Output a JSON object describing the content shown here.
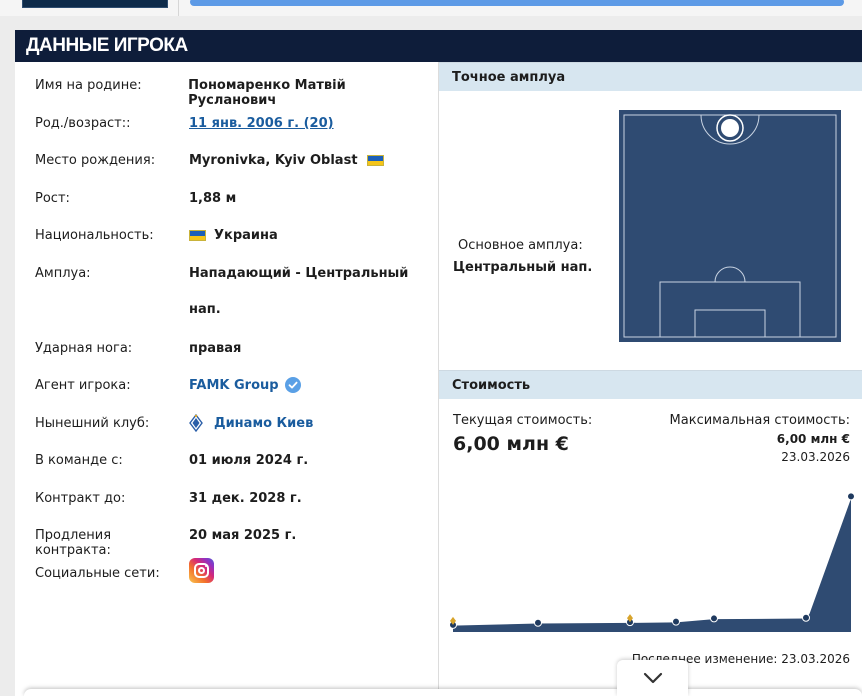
{
  "section_title": "ДАННЫЕ ИГРОКА",
  "info": {
    "name_native": {
      "label": "Имя на родине:",
      "value": "Пономаренко Матвій Русланович"
    },
    "birth": {
      "label": "Род./возраст::",
      "value": "11 янв. 2006 г. (20)"
    },
    "birthplace": {
      "label": "Место рождения:",
      "value": "Myronivka, Kyiv Oblast",
      "flag": "ukraine-flag"
    },
    "height": {
      "label": "Рост:",
      "value": "1,88 м"
    },
    "nationality": {
      "label": "Национальность:",
      "value": "Украина",
      "flag": "ukraine-flag"
    },
    "position": {
      "label": "Амплуа:",
      "value_line1": "Нападающий - Центральный",
      "value_line2": "нап."
    },
    "foot": {
      "label": "Ударная нога:",
      "value": "правая"
    },
    "agent": {
      "label": "Агент игрока:",
      "value": "FAMK Group",
      "icon": "verified-badge-icon"
    },
    "club": {
      "label": "Нынешний клуб:",
      "value": "Динамо Киев",
      "icon": "dynamo-kyiv-logo"
    },
    "joined": {
      "label": "В команде с:",
      "value": "01 июля 2024 г."
    },
    "contract": {
      "label": "Контракт до:",
      "value": "31 дек. 2028 г."
    },
    "extension": {
      "label": "Продления контракта:",
      "value": "20 мая 2025 г."
    },
    "social": {
      "label": "Социальные сети:",
      "icon": "instagram-icon"
    }
  },
  "position_panel": {
    "title": "Точное амплуа",
    "main_label": "Основное амплуа:",
    "main_value": "Центральный нап."
  },
  "market_value": {
    "title": "Стоимость",
    "current_label": "Текущая стоимость:",
    "current_value": "6,00 млн €",
    "max_label": "Максимальная стоимость:",
    "max_value": "6,00 млн €",
    "max_date": "23.03.2026",
    "last_change": "Последнее изменение: 23.03.2026"
  },
  "colors": {
    "header": "#0e1d3a",
    "link": "#1a5c9e",
    "pitch": "#2f4b72",
    "section_bg": "#d7e6f0"
  },
  "chart_data": {
    "type": "area",
    "values": [
      0.05,
      0.15,
      0.18,
      0.2,
      0.35,
      0.38,
      0.6,
      6.0
    ],
    "club_markers": [
      0,
      2
    ],
    "ylim": [
      0,
      6.2
    ]
  }
}
